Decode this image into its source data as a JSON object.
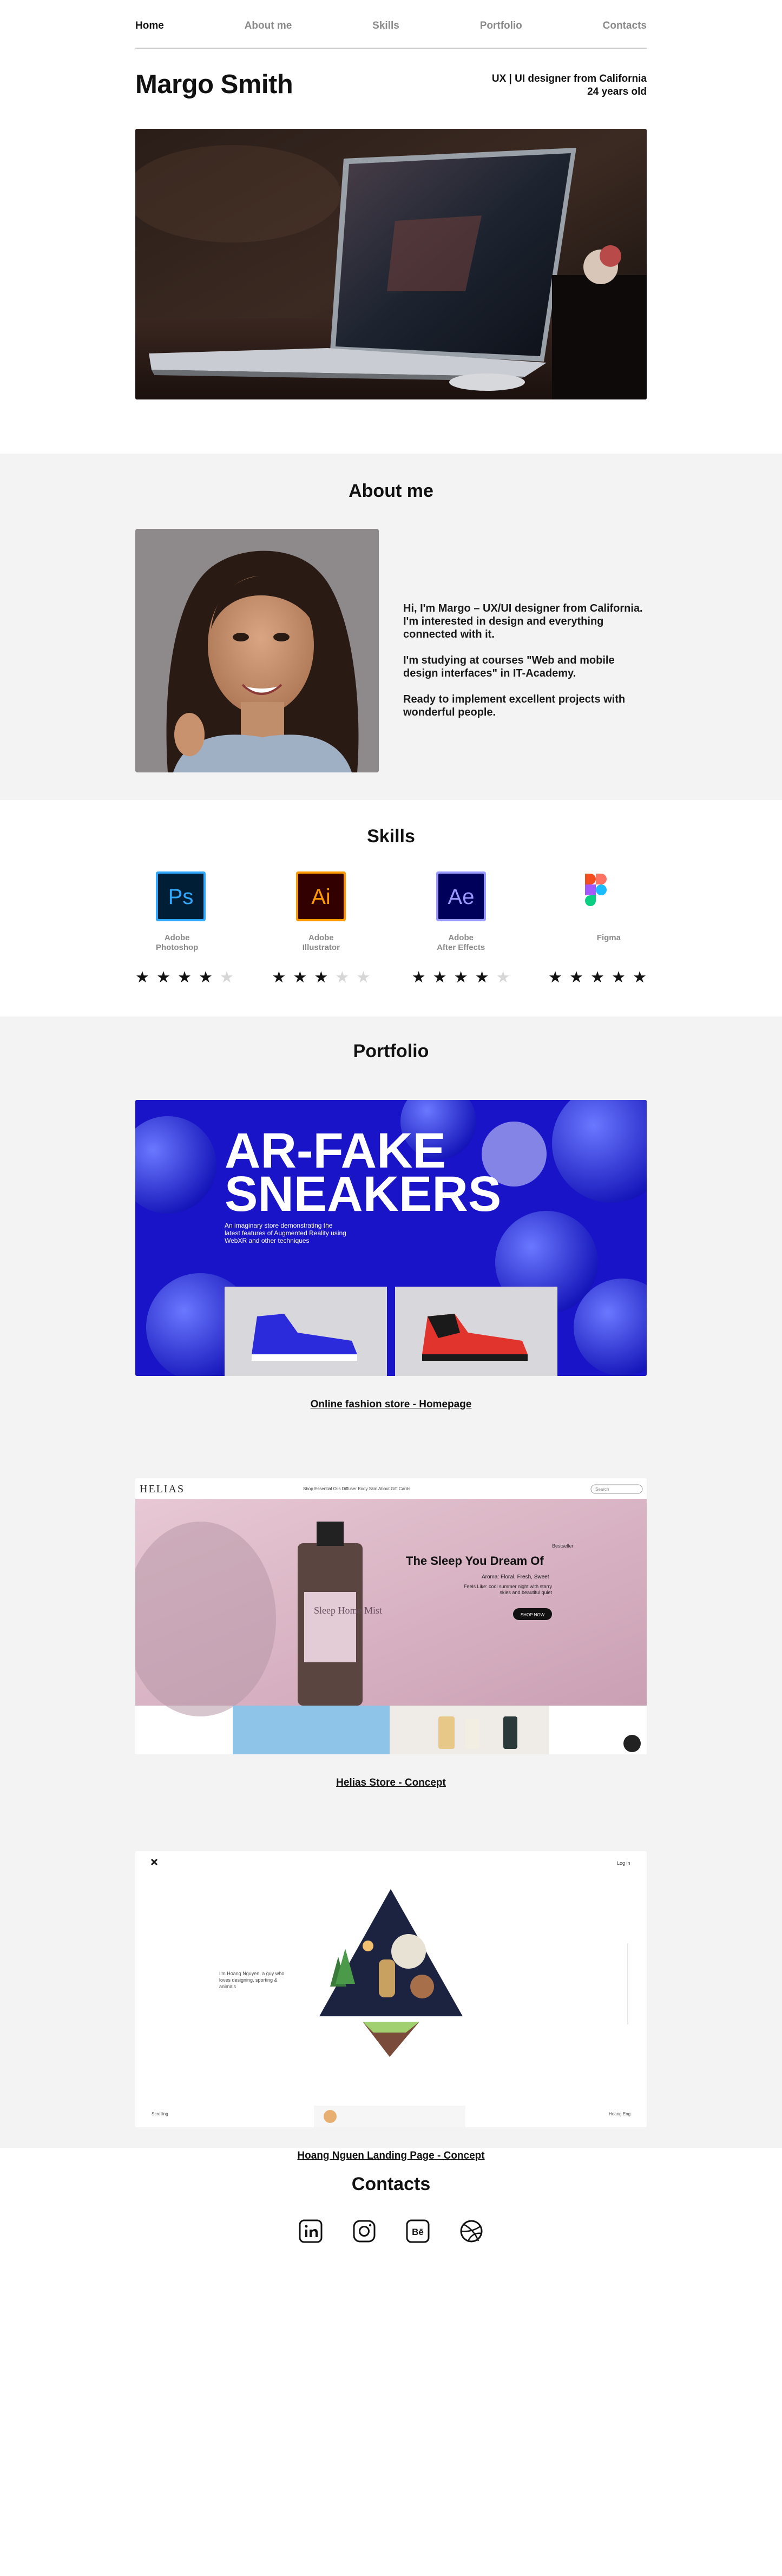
{
  "nav": {
    "items": [
      {
        "label": "Home",
        "active": true
      },
      {
        "label": "About me",
        "active": false
      },
      {
        "label": "Skills",
        "active": false
      },
      {
        "label": "Portfolio",
        "active": false
      },
      {
        "label": "Contacts",
        "active": false
      }
    ]
  },
  "hero": {
    "name": "Margo Smith",
    "role": "UX | UI designer from California",
    "age": "24 years old"
  },
  "about": {
    "title": "About me",
    "paragraphs": [
      "Hi, I'm Margo – UX/UI designer from California. I'm interested in design and everything connected with it.",
      "I'm studying at courses \"Web and mobile design interfaces\" in IT-Academy.",
      "Ready to implement excellent projects with wonderful people."
    ]
  },
  "skills": {
    "title": "Skills",
    "items": [
      {
        "name": "Adobe\nPhotoshop",
        "icon": "photoshop-icon",
        "rating": 4,
        "max": 5,
        "color": "#31a8ff"
      },
      {
        "name": "Adobe\nIllustrator",
        "icon": "illustrator-icon",
        "rating": 3,
        "max": 5,
        "color": "#ff9a00"
      },
      {
        "name": "Adobe\nAfter Effects",
        "icon": "after-effects-icon",
        "rating": 4,
        "max": 5,
        "color": "#9999ff"
      },
      {
        "name": "Figma",
        "icon": "figma-icon",
        "rating": 5,
        "max": 5,
        "color": "#a259ff"
      }
    ]
  },
  "portfolio": {
    "title": "Portfolio",
    "projects": [
      {
        "caption": "Online fashion store - Homepage",
        "headline_1": "AR-FAKE",
        "headline_2": "SNEAKERS",
        "blurb": "An imaginary store demonstrating the latest features of Augmented Reality using WebXR and other techniques"
      },
      {
        "caption": "Helias Store - Concept",
        "logo": "HELIAS",
        "menu": "Shop Essential Oils   Diffuser   Body   Skin   About   Gift Cards",
        "search": "Search",
        "kicker": "Bestseller",
        "headline": "The Sleep You Dream Of",
        "aroma": "Aroma: Floral, Fresh, Sweet",
        "desc": "Feels Like: cool summer night with starry skies and beautiful quiet",
        "cta": "SHOP NOW",
        "bottle": "Sleep Home Mist"
      },
      {
        "caption": "Hoang Nguen Landing Page - Concept",
        "intro": "I'm Hoang Nguyen, a guy who loves designing, sporting & animals",
        "login": "Log in",
        "footer_left": "Scrolling",
        "footer_right": "Hoang Eng"
      }
    ]
  },
  "contacts": {
    "title": "Contacts",
    "links": [
      {
        "icon": "linkedin-icon"
      },
      {
        "icon": "instagram-icon"
      },
      {
        "icon": "behance-icon"
      },
      {
        "icon": "dribbble-icon"
      }
    ]
  }
}
